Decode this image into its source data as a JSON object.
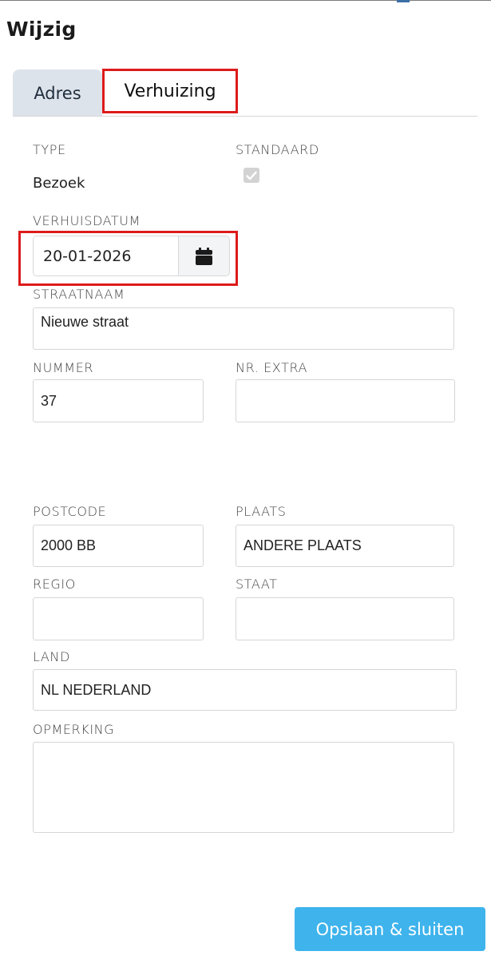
{
  "dialog": {
    "title": "Wijzig"
  },
  "tabs": [
    {
      "label": "Adres",
      "active": false
    },
    {
      "label": "Verhuizing",
      "active": true
    }
  ],
  "fields": {
    "type": {
      "label": "TYPE",
      "value": "Bezoek"
    },
    "standaard": {
      "label": "STANDAARD",
      "checked": true,
      "disabled": true
    },
    "verhuisdatum": {
      "label": "VERHUISDATUM",
      "value": "20-01-2026",
      "icon": "calendar-icon"
    },
    "straatnaam": {
      "label": "STRAATNAAM",
      "value": "Nieuwe straat"
    },
    "nummer": {
      "label": "NUMMER",
      "value": "37"
    },
    "nr_extra": {
      "label": "NR. EXTRA",
      "value": ""
    },
    "postcode": {
      "label": "POSTCODE",
      "value": "2000 BB"
    },
    "plaats": {
      "label": "PLAATS",
      "value": "ANDERE PLAATS"
    },
    "regio": {
      "label": "REGIO",
      "value": ""
    },
    "staat": {
      "label": "STAAT",
      "value": ""
    },
    "land": {
      "label": "LAND",
      "value": "NL NEDERLAND"
    },
    "opmerking": {
      "label": "OPMERKING",
      "value": ""
    }
  },
  "actions": {
    "save_close_label": "Opslaan & sluiten"
  },
  "colors": {
    "highlight": "#dd1b1b",
    "primary_button": "#3eb3ec",
    "inactive_tab": "#dde3ea"
  }
}
